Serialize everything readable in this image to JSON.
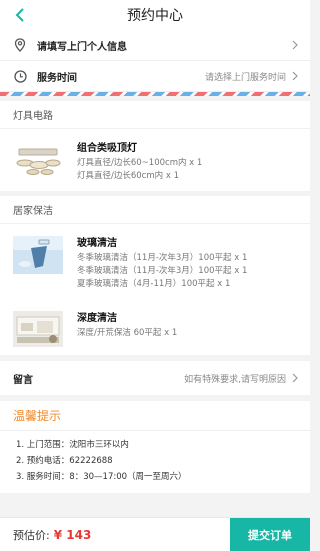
{
  "header": {
    "title": "预约中心"
  },
  "info": {
    "personal": {
      "label": "请填写上门个人信息"
    },
    "service_time": {
      "label": "服务时间",
      "value": "请选择上门服务时间"
    }
  },
  "sections": {
    "lighting": {
      "title": "灯具电路",
      "items": [
        {
          "name": "组合类吸顶灯",
          "lines": [
            "灯具直径/边长60~100cm内 x 1",
            "灯具直径/边长60cm内 x 1"
          ]
        }
      ]
    },
    "cleaning": {
      "title": "居家保洁",
      "items": [
        {
          "name": "玻璃清洁",
          "lines": [
            "冬季玻璃清洁（11月-次年3月）100平起 x 1",
            "冬季玻璃清洁（11月-次年3月）100平起 x 1",
            "夏季玻璃清洁（4月-11月）100平起 x 1"
          ]
        },
        {
          "name": "深度清洁",
          "lines": [
            "深度/开荒保洁 60平起 x 1"
          ]
        }
      ]
    }
  },
  "message": {
    "label": "留言",
    "placeholder": "如有特殊要求,请写明原因"
  },
  "tips": {
    "title": "温馨提示",
    "items": [
      "1. 上门范围：沈阳市三环以内",
      "2. 预约电话：62222688",
      "3. 服务时间：8：30—17:00（周一至周六）"
    ]
  },
  "footer": {
    "price_label": "预估价:",
    "price": "¥ 143",
    "submit_label": "提交订单"
  },
  "colors": {
    "accent": "#17b6a5",
    "price": "#e53935",
    "tips_title": "#f08a2b"
  }
}
